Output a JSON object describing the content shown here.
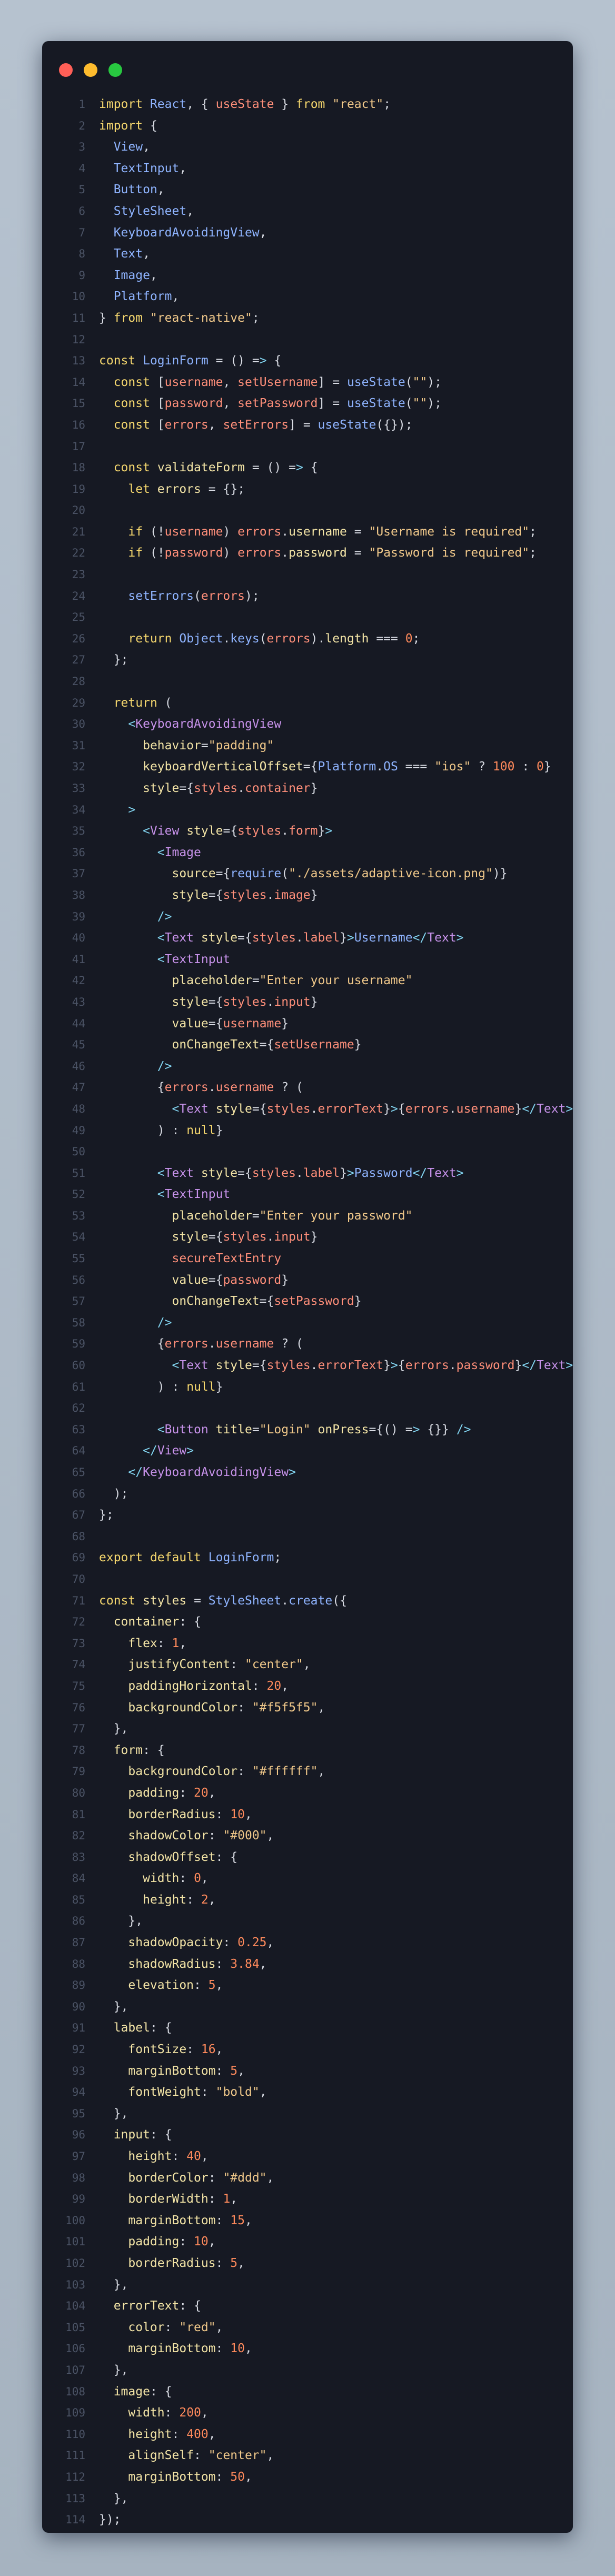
{
  "window": {
    "controls": [
      "close",
      "minimize",
      "maximize"
    ],
    "colors": {
      "background": "#161923",
      "close": "#ff5f57",
      "minimize": "#febc2e",
      "maximize": "#28c840"
    }
  },
  "code": {
    "language": "javascript",
    "lines": [
      "import React, { useState } from \"react\";",
      "import {",
      "  View,",
      "  TextInput,",
      "  Button,",
      "  StyleSheet,",
      "  KeyboardAvoidingView,",
      "  Text,",
      "  Image,",
      "  Platform,",
      "} from \"react-native\";",
      "",
      "const LoginForm = () => {",
      "  const [username, setUsername] = useState(\"\");",
      "  const [password, setPassword] = useState(\"\");",
      "  const [errors, setErrors] = useState({});",
      "",
      "  const validateForm = () => {",
      "    let errors = {};",
      "",
      "    if (!username) errors.username = \"Username is required\";",
      "    if (!password) errors.password = \"Password is required\";",
      "",
      "    setErrors(errors);",
      "",
      "    return Object.keys(errors).length === 0;",
      "  };",
      "",
      "  return (",
      "    <KeyboardAvoidingView",
      "      behavior=\"padding\"",
      "      keyboardVerticalOffset={Platform.OS === \"ios\" ? 100 : 0}",
      "      style={styles.container}",
      "    >",
      "      <View style={styles.form}>",
      "        <Image",
      "          source={require(\"./assets/adaptive-icon.png\")}",
      "          style={styles.image}",
      "        />",
      "        <Text style={styles.label}>Username</Text>",
      "        <TextInput",
      "          placeholder=\"Enter your username\"",
      "          style={styles.input}",
      "          value={username}",
      "          onChangeText={setUsername}",
      "        />",
      "        {errors.username ? (",
      "          <Text style={styles.errorText}>{errors.username}</Text>",
      "        ) : null}",
      "",
      "        <Text style={styles.label}>Password</Text>",
      "        <TextInput",
      "          placeholder=\"Enter your password\"",
      "          style={styles.input}",
      "          secureTextEntry",
      "          value={password}",
      "          onChangeText={setPassword}",
      "        />",
      "        {errors.username ? (",
      "          <Text style={styles.errorText}>{errors.password}</Text>",
      "        ) : null}",
      "",
      "        <Button title=\"Login\" onPress={() => {}} />",
      "      </View>",
      "    </KeyboardAvoidingView>",
      "  );",
      "};",
      "",
      "export default LoginForm;",
      "",
      "const styles = StyleSheet.create({",
      "  container: {",
      "    flex: 1,",
      "    justifyContent: \"center\",",
      "    paddingHorizontal: 20,",
      "    backgroundColor: \"#f5f5f5\",",
      "  },",
      "  form: {",
      "    backgroundColor: \"#ffffff\",",
      "    padding: 20,",
      "    borderRadius: 10,",
      "    shadowColor: \"#000\",",
      "    shadowOffset: {",
      "      width: 0,",
      "      height: 2,",
      "    },",
      "    shadowOpacity: 0.25,",
      "    shadowRadius: 3.84,",
      "    elevation: 5,",
      "  },",
      "  label: {",
      "    fontSize: 16,",
      "    marginBottom: 5,",
      "    fontWeight: \"bold\",",
      "  },",
      "  input: {",
      "    height: 40,",
      "    borderColor: \"#ddd\",",
      "    borderWidth: 1,",
      "    marginBottom: 15,",
      "    padding: 10,",
      "    borderRadius: 5,",
      "  },",
      "  errorText: {",
      "    color: \"red\",",
      "    marginBottom: 10,",
      "  },",
      "  image: {",
      "    width: 200,",
      "    height: 400,",
      "    alignSelf: \"center\",",
      "    marginBottom: 50,",
      "  },",
      "});",
      ""
    ]
  }
}
